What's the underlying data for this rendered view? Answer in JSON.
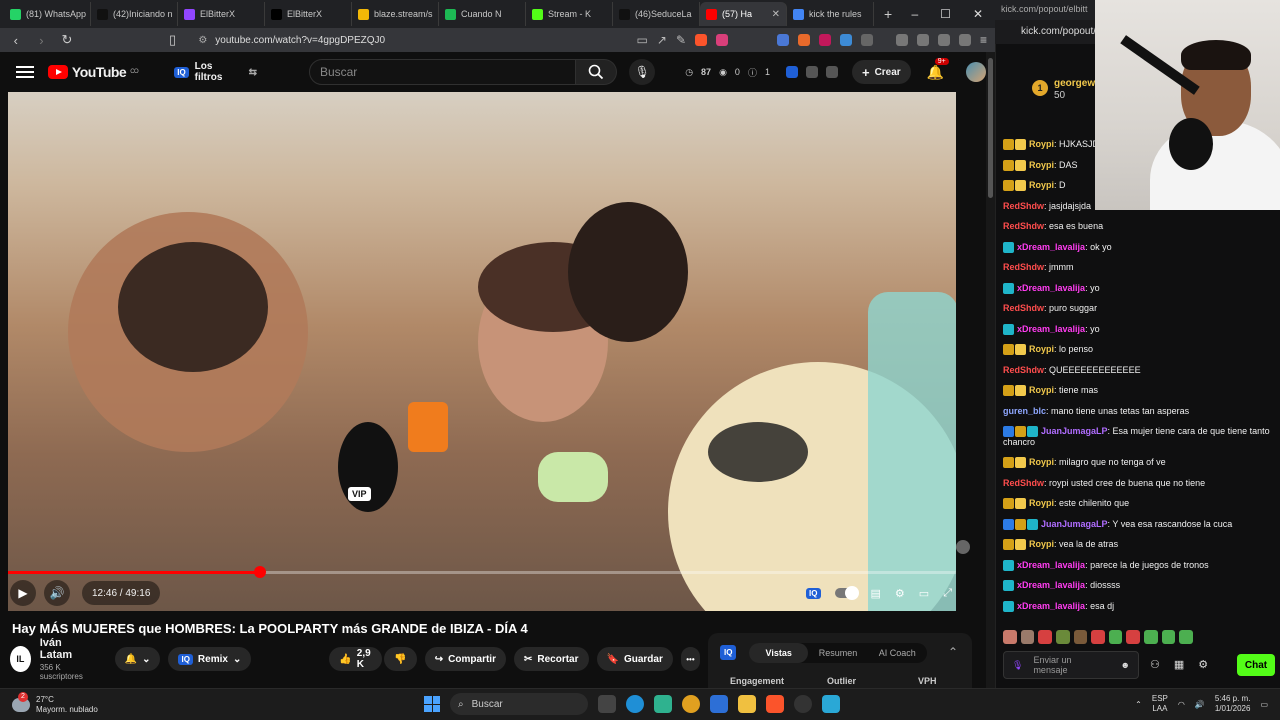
{
  "browser": {
    "tabs": [
      {
        "label": "(81) WhatsApp",
        "color": "#25d366"
      },
      {
        "label": "(42)Iniciando n",
        "color": "#111111"
      },
      {
        "label": "ElBitterX",
        "color": "#9146ff"
      },
      {
        "label": "ElBitterX",
        "color": "#000000"
      },
      {
        "label": "blaze.stream/s",
        "color": "#f2b807"
      },
      {
        "label": "Cuando N",
        "color": "#1db954"
      },
      {
        "label": "Stream - K",
        "color": "#53fc18"
      },
      {
        "label": "(46)SeduceLa",
        "color": "#111111"
      },
      {
        "label": "(57) Ha",
        "color": "#ff0000",
        "active": true
      },
      {
        "label": "kick the rules",
        "color": "#4285f4"
      }
    ],
    "new_tab": "+",
    "window_controls": [
      "–",
      "☐",
      "✕"
    ],
    "url": "youtube.com/watch?v=4gpgDPEZQJ0"
  },
  "youtube": {
    "logo_text": "YouTube",
    "logo_sup": "CO",
    "filters_badge": "IQ",
    "filters_label": "Los filtros",
    "search_placeholder": "Buscar",
    "stats": [
      "87",
      "0",
      "1"
    ],
    "create_label": "Crear",
    "notif_count": "9+"
  },
  "player": {
    "progress": 0.2658,
    "time": "12:46 / 49:16",
    "mic_tag": "VIP"
  },
  "video_info": {
    "title": "Hay MÁS MUJERES que HOMBRES: La POOLPARTY más GRANDE de IBIZA - DÍA 4",
    "channel_avatar": "IL",
    "channel": "Iván Latam",
    "subscribers": "356 K suscriptores",
    "remix": "Remix",
    "likes": "2,9 K",
    "share": "Compartir",
    "clip": "Recortar",
    "save": "Guardar",
    "more": "•••"
  },
  "iq_panel": {
    "badge": "IQ",
    "tabs": [
      "Vistas",
      "Resumen",
      "AI Coach"
    ],
    "columns": [
      "Engagement",
      "Outlier",
      "VPH"
    ]
  },
  "kick": {
    "top_url": "kick.com/popout/elbitt",
    "url": "kick.com/popout/elbitt",
    "pinned_user": "georgew",
    "pinned_rank": "1",
    "pinned_amount": "50",
    "messages": [
      {
        "user": "Roypi",
        "color": "#f2c94c",
        "badges": [
          "#d4a017",
          "#f2c94c"
        ],
        "text": "HJKASJDSJA"
      },
      {
        "user": "Roypi",
        "color": "#f2c94c",
        "badges": [
          "#d4a017",
          "#f2c94c"
        ],
        "text": "DAS"
      },
      {
        "user": "Roypi",
        "color": "#f2c94c",
        "badges": [
          "#d4a017",
          "#f2c94c"
        ],
        "text": "D"
      },
      {
        "user": "RedShdw",
        "color": "#ff4d4d",
        "badges": [],
        "text": "jasjdajsjda"
      },
      {
        "user": "RedShdw",
        "color": "#ff4d4d",
        "badges": [],
        "text": "esa es buena"
      },
      {
        "user": "xDream_lavalija",
        "color": "#ff3df0",
        "badges": [
          "#1fb5c9"
        ],
        "text": "ok yo"
      },
      {
        "user": "RedShdw",
        "color": "#ff4d4d",
        "badges": [],
        "text": "jmmm"
      },
      {
        "user": "xDream_lavalija",
        "color": "#ff3df0",
        "badges": [
          "#1fb5c9"
        ],
        "text": "yo"
      },
      {
        "user": "RedShdw",
        "color": "#ff4d4d",
        "badges": [],
        "text": "puro suggar"
      },
      {
        "user": "xDream_lavalija",
        "color": "#ff3df0",
        "badges": [
          "#1fb5c9"
        ],
        "text": "yo"
      },
      {
        "user": "Roypi",
        "color": "#f2c94c",
        "badges": [
          "#d4a017",
          "#f2c94c"
        ],
        "text": "lo penso"
      },
      {
        "user": "RedShdw",
        "color": "#ff4d4d",
        "badges": [],
        "text": "QUEEEEEEEEEEEEE"
      },
      {
        "user": "Roypi",
        "color": "#f2c94c",
        "badges": [
          "#d4a017",
          "#f2c94c"
        ],
        "text": "tiene mas"
      },
      {
        "user": "guren_blc",
        "color": "#8fa7ff",
        "badges": [],
        "text": "mano tiene unas tetas tan asperas"
      },
      {
        "user": "JuanJumagaLP",
        "color": "#b06dff",
        "badges": [
          "#2c7be5",
          "#d4a017",
          "#1fb5c9"
        ],
        "text": "Esa mujer tiene cara de que tiene tanto chancro"
      },
      {
        "user": "Roypi",
        "color": "#f2c94c",
        "badges": [
          "#d4a017",
          "#f2c94c"
        ],
        "text": "milagro que no tenga of ve"
      },
      {
        "user": "RedShdw",
        "color": "#ff4d4d",
        "badges": [],
        "text": "roypi usted cree de buena que no tiene"
      },
      {
        "user": "Roypi",
        "color": "#f2c94c",
        "badges": [
          "#d4a017",
          "#f2c94c"
        ],
        "text": "este chilenito que"
      },
      {
        "user": "JuanJumagaLP",
        "color": "#b06dff",
        "badges": [
          "#2c7be5",
          "#d4a017",
          "#1fb5c9"
        ],
        "text": "Y vea esa rascandose la cuca"
      },
      {
        "user": "Roypi",
        "color": "#f2c94c",
        "badges": [
          "#d4a017",
          "#f2c94c"
        ],
        "text": "vea la de atras"
      },
      {
        "user": "xDream_lavalija",
        "color": "#ff3df0",
        "badges": [
          "#1fb5c9"
        ],
        "text": "parece la de juegos de tronos"
      },
      {
        "user": "xDream_lavalija",
        "color": "#ff3df0",
        "badges": [
          "#1fb5c9"
        ],
        "text": "diossss"
      },
      {
        "user": "xDream_lavalija",
        "color": "#ff3df0",
        "badges": [
          "#1fb5c9"
        ],
        "text": "esa dj"
      }
    ],
    "input_placeholder": "Enviar un mensaje",
    "chat_button": "Chat"
  },
  "taskbar": {
    "temperature": "27°C",
    "weather": "Mayorm. nublado",
    "weather_badge": "2",
    "search_label": "Buscar",
    "lang": "ESP",
    "lang2": "LAA",
    "time": "5:46 p. m.",
    "date": "1/01/2026"
  }
}
